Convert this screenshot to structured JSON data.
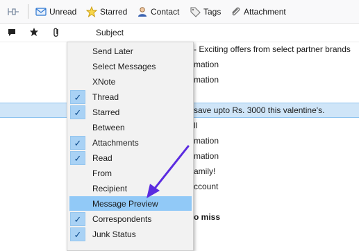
{
  "colors": {
    "toolbar_bg": "#f9f9fa",
    "menu_bg": "#f2f2f2",
    "highlight": "#91c9f7",
    "check_bg": "#a9d2f5",
    "selected_row": "#cfe5f8",
    "annotation_arrow": "#5b2be0"
  },
  "toolbar": {
    "unread": "Unread",
    "starred": "Starred",
    "contact": "Contact",
    "tags": "Tags",
    "attachment": "Attachment"
  },
  "columns": {
    "subject": "Subject"
  },
  "rows": [
    "- Exciting offers from select partner brands",
    "mation",
    "mation",
    "save upto Rs. 3000 this valentine's.",
    "ll",
    "mation",
    "mation",
    "amily!",
    "ccount",
    "",
    "o miss"
  ],
  "menu": {
    "items": [
      {
        "label": "Send Later",
        "checked": false
      },
      {
        "label": "Select Messages",
        "checked": false
      },
      {
        "label": "XNote",
        "checked": false
      },
      {
        "label": "Thread",
        "checked": true
      },
      {
        "label": "Starred",
        "checked": true
      },
      {
        "label": "Between",
        "checked": false
      },
      {
        "label": "Attachments",
        "checked": true
      },
      {
        "label": "Read",
        "checked": true
      },
      {
        "label": "From",
        "checked": false
      },
      {
        "label": "Recipient",
        "checked": false
      },
      {
        "label": "Message Preview",
        "checked": false,
        "highlighted": true
      },
      {
        "label": "Correspondents",
        "checked": true
      },
      {
        "label": "Junk Status",
        "checked": true
      }
    ]
  }
}
